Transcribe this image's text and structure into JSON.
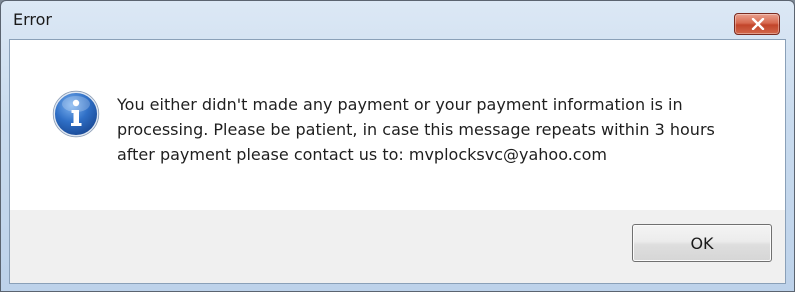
{
  "window": {
    "title": "Error"
  },
  "titlebar": {
    "close_icon": "close-icon"
  },
  "dialog": {
    "icon": "info-icon",
    "message": "You either didn't made any payment or your payment information is in processing. Please be patient, in case this message repeats within 3 hours after payment please contact us to: mvplocksvc@yahoo.com"
  },
  "buttons": {
    "ok_label": "OK"
  },
  "colors": {
    "close_button": "#c9533a",
    "info_icon": "#2a6bc2",
    "content_bg": "#ffffff",
    "button_area_bg": "#f0f0f0"
  }
}
